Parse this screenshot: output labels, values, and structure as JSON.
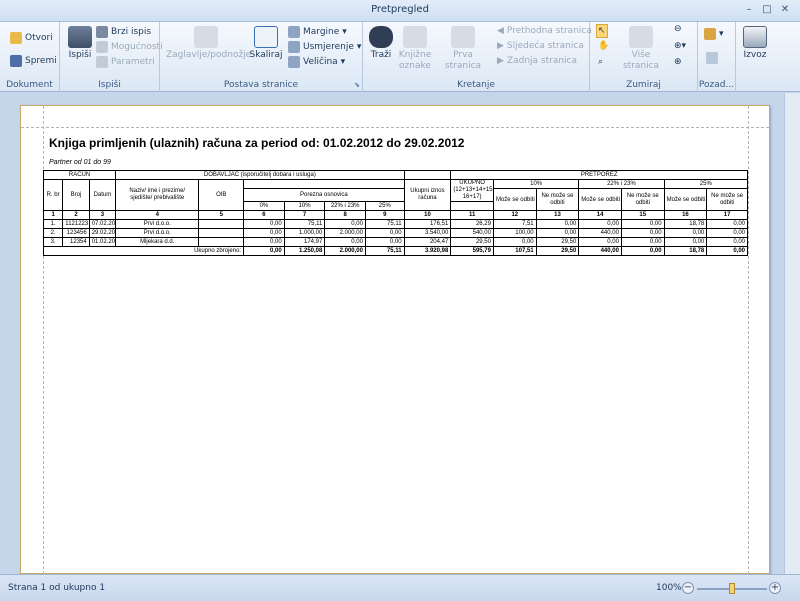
{
  "window": {
    "title": "Pretpregled"
  },
  "ribbon": {
    "dokument": {
      "label": "Dokument",
      "otvori": "Otvori",
      "spremi": "Spremi"
    },
    "ispisi_group": {
      "label": "Ispiši",
      "ispisi": "Ispiši",
      "brzi_ispis": "Brzi ispis",
      "mogucnosti": "Mogućnosti",
      "parametri": "Parametri"
    },
    "postava": {
      "label": "Postava stranice",
      "zaglavlje": "Zaglavlje/podnožje",
      "skaliraj": "Skaliraj",
      "margine": "Margine",
      "usmjerenje": "Usmjerenje",
      "velicina": "Veličina"
    },
    "kretanje": {
      "label": "Kretanje",
      "trazi": "Traži",
      "knjizne1": "Knjižne",
      "knjizne2": "oznake",
      "prva": "Prva stranica",
      "prethodna": "Prethodna stranica",
      "sljedeca": "Sljedeća stranica",
      "zadnja": "Zadnja stranica"
    },
    "zumiraj": {
      "label": "Zumiraj",
      "vise": "Više stranica"
    },
    "pozadina": {
      "label": "Pozad..."
    },
    "izvoz": {
      "label": "Izvoz"
    }
  },
  "report": {
    "title": "Knjiga primljenih (ulaznih) računa za period od: 01.02.2012 do 29.02.2012",
    "partner": "Partner od 01 do 99",
    "h_racun": "RAČUN",
    "h_dobavljac": "DOBAVLJAČ (isporučitelj dobara i usluga)",
    "h_pretporez": "PRETPOREZ",
    "h_rbr": "R. br",
    "h_broj": "Broj",
    "h_datum": "Datum",
    "h_naziv": "Naziv/ ime i prezime/ sjedište/ prebivalište",
    "h_oib": "OIB",
    "h_porezna": "Porezna osnovica",
    "h_ukupni": "Ukupni iznos računa",
    "h_ukupno": "UKUPNO (12+13+14+15+ 16+17)",
    "h_10": "10%",
    "h_22": "22% i 23%",
    "h_25": "25%",
    "h_moze": "Može se odbiti",
    "h_nemoze": "Ne može se odbiti",
    "p_0": "0%",
    "p_10": "10%",
    "p_22": "22% i 23%",
    "p_25": "25%",
    "nums": [
      "1",
      "2",
      "3",
      "4",
      "5",
      "6",
      "7",
      "8",
      "9",
      "10",
      "11",
      "12",
      "13",
      "14",
      "15",
      "16",
      "17"
    ],
    "rows": [
      [
        "1.",
        "1121223",
        "07.02.201",
        "Prvi d.o.o.",
        "",
        "0,00",
        "75,11",
        "0,00",
        "75,11",
        "176,51",
        "26,29",
        "7,51",
        "0,00",
        "0,00",
        "0,00",
        "18,78",
        "0,00"
      ],
      [
        "2.",
        "123456",
        "29.02.201",
        "Prvi d.o.o.",
        "",
        "0,00",
        "1.000,00",
        "2.000,00",
        "0,00",
        "3.540,00",
        "540,00",
        "100,00",
        "0,00",
        "440,00",
        "0,00",
        "0,00",
        "0,00"
      ],
      [
        "3.",
        "12354",
        "01.02.201",
        "Mljekara d.d.",
        "",
        "0,00",
        "174,97",
        "0,00",
        "0,00",
        "204,47",
        "29,50",
        "0,00",
        "29,50",
        "0,00",
        "0,00",
        "0,00",
        "0,00"
      ]
    ],
    "total_label": "Ukupno zbrojeno:",
    "totals": [
      "0,00",
      "1.250,08",
      "2.000,00",
      "75,11",
      "3.920,98",
      "595,79",
      "107,51",
      "29,50",
      "440,00",
      "0,00",
      "18,78",
      "0,00"
    ]
  },
  "status": {
    "text": "Strana 1 od ukupno 1",
    "zoom": "100%"
  },
  "zoom_fraction": 0.5
}
